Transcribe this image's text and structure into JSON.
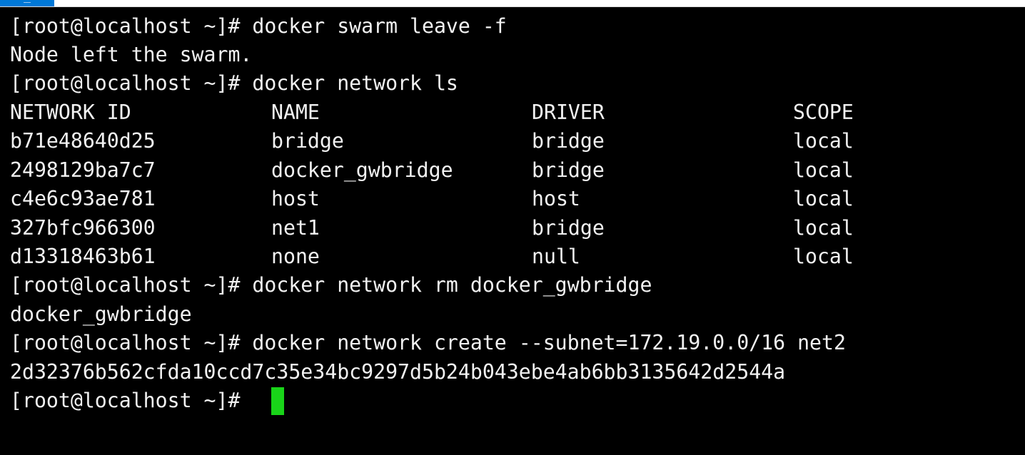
{
  "terminal": {
    "prompt": "[root@localhost ~]#",
    "lines": [
      "[root@localhost ~]# docker swarm leave -f",
      "Node left the swarm.",
      "[root@localhost ~]# docker network ls"
    ],
    "table": {
      "headers": [
        "NETWORK ID",
        "NAME",
        "DRIVER",
        "SCOPE"
      ],
      "rows": [
        [
          "b71e48640d25",
          "bridge",
          "bridge",
          "local"
        ],
        [
          "2498129ba7c7",
          "docker_gwbridge",
          "bridge",
          "local"
        ],
        [
          "c4e6c93ae781",
          "host",
          "host",
          "local"
        ],
        [
          "327bfc966300",
          "net1",
          "bridge",
          "local"
        ],
        [
          "d13318463b61",
          "none",
          "null",
          "local"
        ]
      ]
    },
    "after": [
      "[root@localhost ~]# docker network rm docker_gwbridge",
      "docker_gwbridge",
      "[root@localhost ~]# docker network create --subnet=172.19.0.0/16 net2",
      "2d32376b562cfda10ccd7c35e34bc9297d5b24b043ebe4ab6bb3135642d2544a"
    ],
    "cursor_color": "#19d419"
  }
}
